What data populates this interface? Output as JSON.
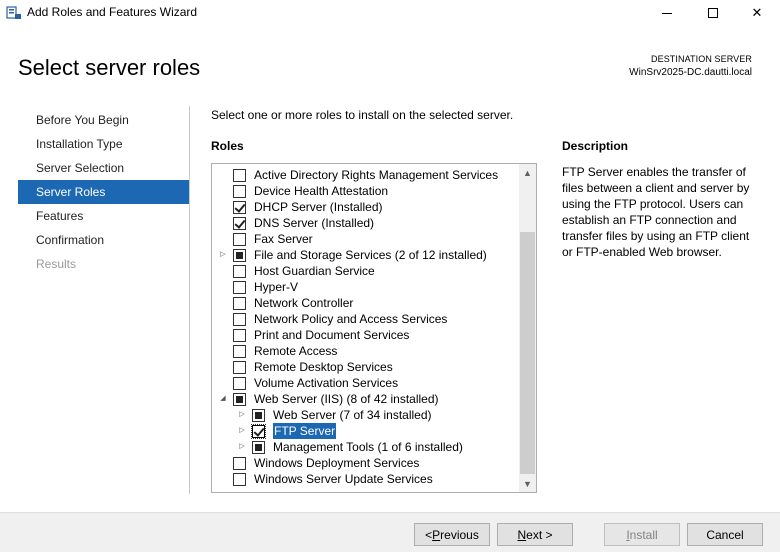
{
  "window": {
    "title": "Add Roles and Features Wizard",
    "minimize_glyph": "—",
    "close_glyph": "✕"
  },
  "header": {
    "title": "Select server roles",
    "destination_label": "DESTINATION SERVER",
    "destination_value": "WinSrv2025-DC.dautti.local"
  },
  "nav": {
    "items": [
      {
        "label": "Before You Begin",
        "state": "normal"
      },
      {
        "label": "Installation Type",
        "state": "normal"
      },
      {
        "label": "Server Selection",
        "state": "normal"
      },
      {
        "label": "Server Roles",
        "state": "active"
      },
      {
        "label": "Features",
        "state": "normal"
      },
      {
        "label": "Confirmation",
        "state": "normal"
      },
      {
        "label": "Results",
        "state": "disabled"
      }
    ]
  },
  "main": {
    "instruction": "Select one or more roles to install on the selected server.",
    "roles_heading": "Roles",
    "roles": [
      {
        "label": "Active Directory Rights Management Services",
        "state": "unchecked",
        "level": 0,
        "expander": ""
      },
      {
        "label": "Device Health Attestation",
        "state": "unchecked",
        "level": 0,
        "expander": ""
      },
      {
        "label": "DHCP Server (Installed)",
        "state": "checked",
        "level": 0,
        "expander": ""
      },
      {
        "label": "DNS Server (Installed)",
        "state": "checked",
        "level": 0,
        "expander": ""
      },
      {
        "label": "Fax Server",
        "state": "unchecked",
        "level": 0,
        "expander": ""
      },
      {
        "label": "File and Storage Services (2 of 12 installed)",
        "state": "partial",
        "level": 0,
        "expander": "collapsed"
      },
      {
        "label": "Host Guardian Service",
        "state": "unchecked",
        "level": 0,
        "expander": ""
      },
      {
        "label": "Hyper-V",
        "state": "unchecked",
        "level": 0,
        "expander": ""
      },
      {
        "label": "Network Controller",
        "state": "unchecked",
        "level": 0,
        "expander": ""
      },
      {
        "label": "Network Policy and Access Services",
        "state": "unchecked",
        "level": 0,
        "expander": ""
      },
      {
        "label": "Print and Document Services",
        "state": "unchecked",
        "level": 0,
        "expander": ""
      },
      {
        "label": "Remote Access",
        "state": "unchecked",
        "level": 0,
        "expander": ""
      },
      {
        "label": "Remote Desktop Services",
        "state": "unchecked",
        "level": 0,
        "expander": ""
      },
      {
        "label": "Volume Activation Services",
        "state": "unchecked",
        "level": 0,
        "expander": ""
      },
      {
        "label": "Web Server (IIS) (8 of 42 installed)",
        "state": "partial",
        "level": 0,
        "expander": "expanded"
      },
      {
        "label": "Web Server (7 of 34 installed)",
        "state": "partial",
        "level": 1,
        "expander": "collapsed"
      },
      {
        "label": "FTP Server",
        "state": "checked",
        "level": 1,
        "expander": "collapsed",
        "selected": true
      },
      {
        "label": "Management Tools (1 of 6 installed)",
        "state": "partial",
        "level": 1,
        "expander": "collapsed"
      },
      {
        "label": "Windows Deployment Services",
        "state": "unchecked",
        "level": 0,
        "expander": ""
      },
      {
        "label": "Windows Server Update Services",
        "state": "unchecked",
        "level": 0,
        "expander": ""
      }
    ]
  },
  "description": {
    "heading": "Description",
    "text": "FTP Server enables the transfer of files between a client and server by using the FTP protocol. Users can establish an FTP connection and transfer files by using an FTP client or FTP-enabled Web browser."
  },
  "buttons": {
    "previous": "< Previous",
    "next": "Next >",
    "install": "Install",
    "cancel": "Cancel"
  },
  "colors": {
    "accent": "#1c68b3"
  }
}
